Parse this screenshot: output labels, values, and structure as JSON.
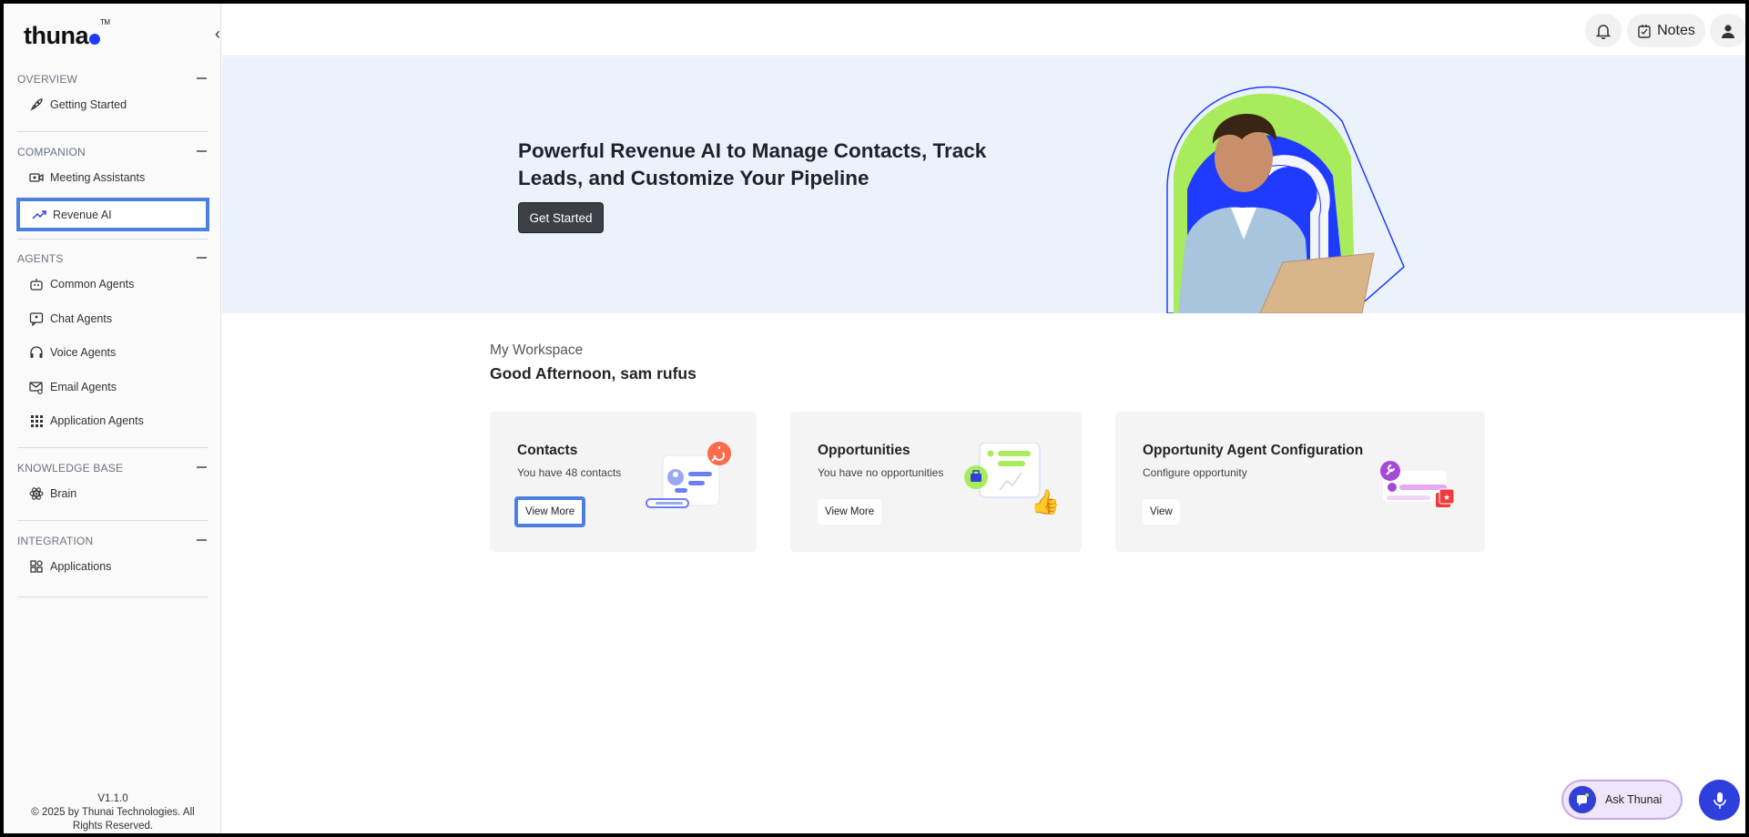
{
  "brand": {
    "logo_text": "thuna",
    "tm": "TM"
  },
  "sidebar": {
    "collapse_glyph": "‹",
    "sections": [
      {
        "title": "OVERVIEW",
        "items": [
          {
            "label": "Getting Started",
            "icon": "rocket-icon"
          }
        ]
      },
      {
        "title": "COMPANION",
        "items": [
          {
            "label": "Meeting Assistants",
            "icon": "video-camera-icon"
          },
          {
            "label": "Revenue AI",
            "icon": "trending-up-icon",
            "active": true
          }
        ]
      },
      {
        "title": "AGENTS",
        "items": [
          {
            "label": "Common Agents",
            "icon": "robot-icon"
          },
          {
            "label": "Chat Agents",
            "icon": "chat-icon"
          },
          {
            "label": "Voice Agents",
            "icon": "headset-icon"
          },
          {
            "label": "Email Agents",
            "icon": "mail-icon"
          },
          {
            "label": "Application Agents",
            "icon": "grid-icon"
          }
        ]
      },
      {
        "title": "KNOWLEDGE BASE",
        "items": [
          {
            "label": "Brain",
            "icon": "atom-icon"
          }
        ]
      },
      {
        "title": "INTEGRATION",
        "items": [
          {
            "label": "Applications",
            "icon": "apps-icon"
          }
        ]
      }
    ],
    "version": "V1.1.0",
    "copyright": "© 2025 by Thunai Technologies. All Rights Reserved."
  },
  "header": {
    "notes_label": "Notes"
  },
  "hero": {
    "title": "Powerful Revenue AI to Manage Contacts, Track Leads, and Customize Your Pipeline",
    "cta_label": "Get Started"
  },
  "workspace": {
    "subtitle": "My Workspace",
    "greeting": "Good Afternoon, sam rufus",
    "cards": [
      {
        "title": "Contacts",
        "description": "You have 48 contacts",
        "button": "View More"
      },
      {
        "title": "Opportunities",
        "description": "You have no opportunities",
        "button": "View More"
      },
      {
        "title": "Opportunity Agent Configuration",
        "description": "Configure opportunity",
        "button": "View"
      }
    ]
  },
  "assistant": {
    "ask_label": "Ask Thunai"
  },
  "colors": {
    "accent": "#2f3fdc",
    "highlight": "#4b7fe0",
    "hero_bg": "#ebf2fc",
    "lime": "#a8ec5c"
  }
}
